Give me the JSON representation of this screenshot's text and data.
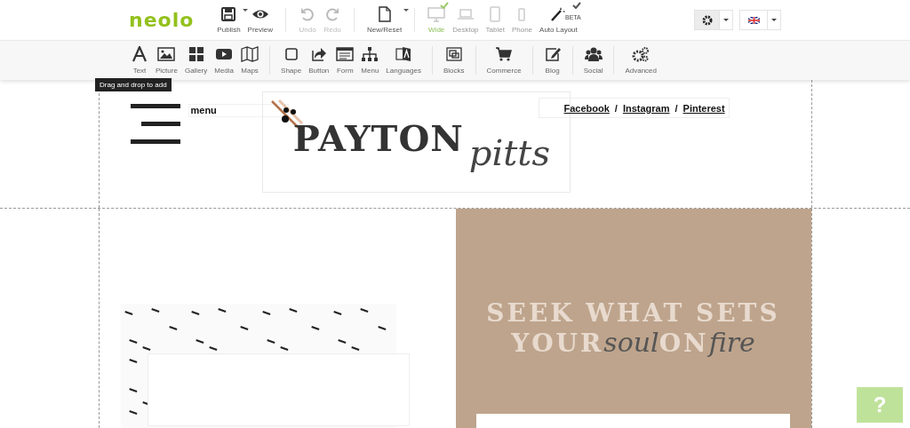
{
  "app": {
    "logo": "neolo"
  },
  "top_actions": [
    {
      "label": "Publish",
      "kind": "save",
      "dropdown": true,
      "disabled": false
    },
    {
      "label": "Preview",
      "kind": "eye",
      "dropdown": false,
      "disabled": false
    },
    {
      "label": "Undo",
      "kind": "undo",
      "dropdown": false,
      "disabled": true
    },
    {
      "label": "Redo",
      "kind": "redo",
      "dropdown": false,
      "disabled": true
    },
    {
      "label": "New/Reset",
      "kind": "page",
      "dropdown": true,
      "disabled": false
    }
  ],
  "devices": [
    {
      "label": "Wide",
      "kind": "monitor",
      "selected": true
    },
    {
      "label": "Desktop",
      "kind": "laptop",
      "selected": false
    },
    {
      "label": "Tablet",
      "kind": "tablet",
      "selected": false
    },
    {
      "label": "Phone",
      "kind": "phone",
      "selected": false
    }
  ],
  "auto_layout": {
    "label": "Auto Layout",
    "badge": "BETA",
    "checked": true
  },
  "toolbar_groups": [
    [
      {
        "label": "Text",
        "kind": "text"
      },
      {
        "label": "Picture",
        "kind": "picture"
      },
      {
        "label": "Gallery",
        "kind": "gallery"
      },
      {
        "label": "Media",
        "kind": "media"
      },
      {
        "label": "Maps",
        "kind": "map"
      }
    ],
    [
      {
        "label": "Shape",
        "kind": "shape"
      },
      {
        "label": "Button",
        "kind": "share"
      },
      {
        "label": "Form",
        "kind": "form"
      },
      {
        "label": "Menu",
        "kind": "sitemap"
      },
      {
        "label": "Languages",
        "kind": "translate"
      }
    ],
    [
      {
        "label": "Blocks",
        "kind": "blocks"
      }
    ],
    [
      {
        "label": "Commerce",
        "kind": "cart"
      }
    ],
    [
      {
        "label": "Blog",
        "kind": "edit"
      }
    ],
    [
      {
        "label": "Social",
        "kind": "users"
      }
    ],
    [
      {
        "label": "Advanced",
        "kind": "gears"
      }
    ]
  ],
  "tooltip": "Drag and drop to add",
  "header": {
    "menu_label": "menu",
    "logo_main": "PAYTON",
    "logo_script": "pitts",
    "social_links": [
      "Facebook",
      "Instagram",
      "Pinterest"
    ],
    "separator": "/"
  },
  "hero": {
    "line_1": "SEEK WHAT SETS",
    "line_2_start": "YOUR",
    "line_2_script_1": "soul",
    "line_2_middle": "ON",
    "line_2_script_2": "fire"
  },
  "help_button": "?"
}
